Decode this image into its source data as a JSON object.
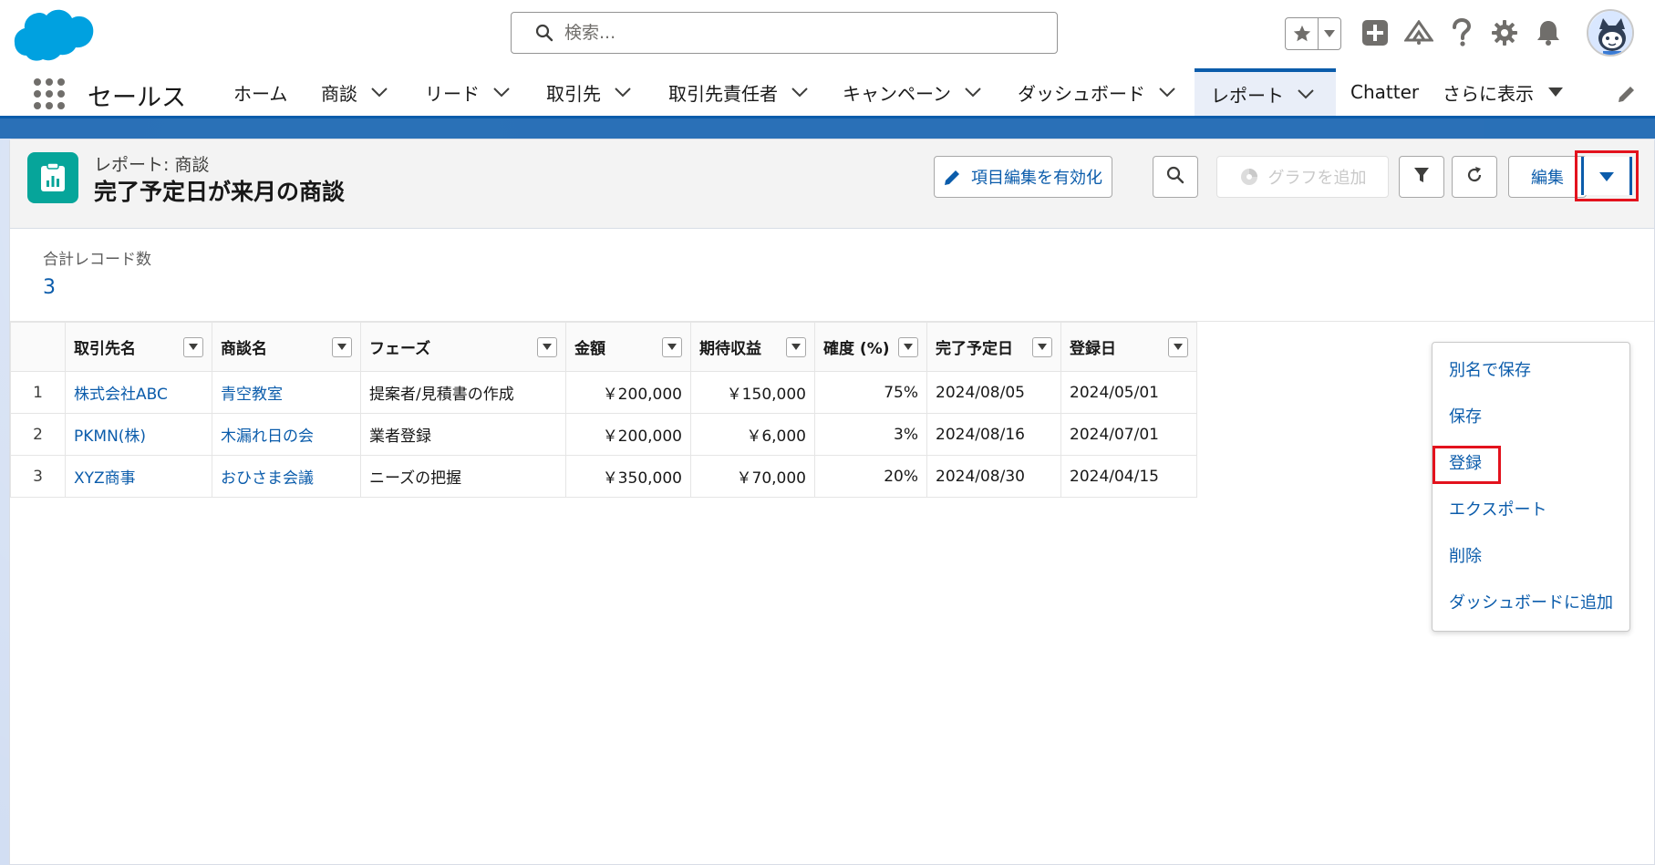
{
  "header": {
    "search_placeholder": "検索...",
    "icons": [
      "star-icon",
      "plus-icon",
      "trailhead-icon",
      "help-icon",
      "gear-icon",
      "bell-icon",
      "avatar"
    ]
  },
  "nav": {
    "app_name": "セールス",
    "items": [
      {
        "label": "ホーム",
        "has_menu": false
      },
      {
        "label": "商談",
        "has_menu": true
      },
      {
        "label": "リード",
        "has_menu": true
      },
      {
        "label": "取引先",
        "has_menu": true
      },
      {
        "label": "取引先責任者",
        "has_menu": true
      },
      {
        "label": "キャンペーン",
        "has_menu": true
      },
      {
        "label": "ダッシュボード",
        "has_menu": true
      },
      {
        "label": "レポート",
        "has_menu": true,
        "active": true
      },
      {
        "label": "Chatter",
        "has_menu": false
      },
      {
        "label": "さらに表示",
        "has_menu": true
      }
    ]
  },
  "report": {
    "type_label": "レポート: 商談",
    "title": "完了予定日が来月の商談",
    "buttons": {
      "inline_edit": "項目編集を有効化",
      "add_chart": "グラフを追加",
      "edit": "編集"
    },
    "summary": {
      "label": "合計レコード数",
      "value": "3"
    },
    "columns": [
      "取引先名",
      "商談名",
      "フェーズ",
      "金額",
      "期待収益",
      "確度 (%)",
      "完了予定日",
      "登録日"
    ],
    "rows": [
      {
        "num": "1",
        "account": "株式会社ABC",
        "opportunity": "青空教室",
        "phase": "提案者/見積書の作成",
        "amount": "￥200,000",
        "expected": "￥150,000",
        "probability": "75%",
        "close_date": "2024/08/05",
        "created": "2024/05/01"
      },
      {
        "num": "2",
        "account": "PKMN(株)",
        "opportunity": "木漏れ日の会",
        "phase": "業者登録",
        "amount": "￥200,000",
        "expected": "￥6,000",
        "probability": "3%",
        "close_date": "2024/08/16",
        "created": "2024/07/01"
      },
      {
        "num": "3",
        "account": "XYZ商事",
        "opportunity": "おひさま会議",
        "phase": "ニーズの把握",
        "amount": "￥350,000",
        "expected": "￥70,000",
        "probability": "20%",
        "close_date": "2024/08/30",
        "created": "2024/04/15"
      }
    ]
  },
  "dropdown": {
    "items": [
      "別名で保存",
      "保存",
      "登録",
      "エクスポート",
      "削除",
      "ダッシュボードに追加"
    ],
    "highlighted": "登録"
  },
  "colors": {
    "brand_blue": "#0b5cab",
    "report_icon": "#06a59a",
    "highlight_red": "#e3121d"
  }
}
